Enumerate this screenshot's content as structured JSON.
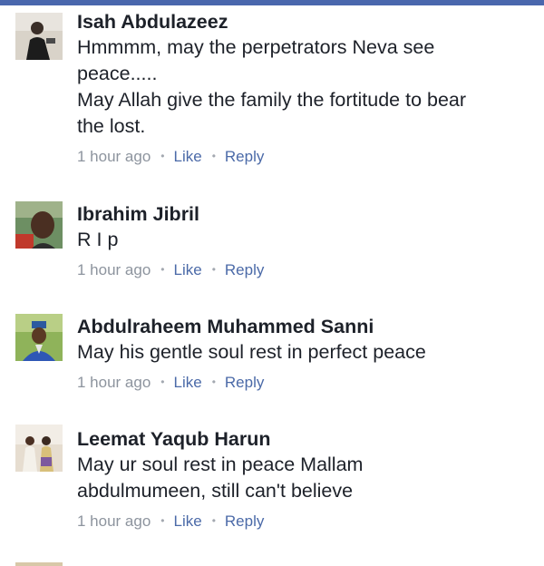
{
  "accent": "#4a67ad",
  "comments": [
    {
      "author": "Isah Abdulazeez",
      "text": "Hmmmm, may the perpetrators Neva see\npeace.....\nMay Allah give the family the fortitude to bear\nthe lost.",
      "time": "1 hour ago",
      "like_label": "Like",
      "reply_label": "Reply"
    },
    {
      "author": "Ibrahim Jibril",
      "text": "R I p",
      "time": "1 hour ago",
      "like_label": "Like",
      "reply_label": "Reply"
    },
    {
      "author": "Abdulraheem Muhammed Sanni",
      "text": "May his gentle soul rest in perfect peace",
      "time": "1 hour ago",
      "like_label": "Like",
      "reply_label": "Reply"
    },
    {
      "author": "Leemat Yaqub Harun",
      "text": "May ur soul rest in peace Mallam\nabdulmumeen, still can't believe",
      "time": "1 hour ago",
      "like_label": "Like",
      "reply_label": "Reply"
    }
  ],
  "separator": "•"
}
